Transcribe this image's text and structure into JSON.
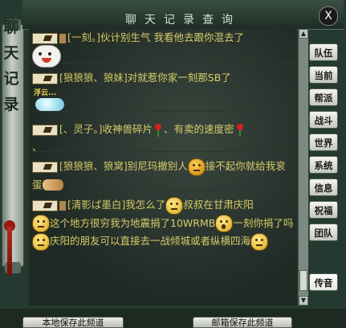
{
  "window": {
    "title": "聊天记录查询",
    "close_label": "X"
  },
  "side_banner": {
    "chars": [
      "聊",
      "天",
      "记",
      "录"
    ]
  },
  "messages": [
    {
      "sender": "[一刻。]",
      "text": "伙计别生气 我看他去跟你混去了",
      "sticker": "smile-face-icon"
    },
    {
      "sender": "[狼狼狼、狼妹]",
      "text": "对就惹你家一刻那SB了",
      "sticker_label": "浮云..."
    },
    {
      "sender": "[、灵子。]",
      "text_a": "收神兽碎片",
      "text_b": "、有卖的速度密",
      "text_c": "、"
    },
    {
      "sender": "[狼狼狼、狼窝]",
      "text_a": "别尼玛撤别人",
      "text_b": "接不起你就给我衮蛋"
    },
    {
      "sender": "[清影ぱ墨白]",
      "text_a": "我怎么了",
      "text_b": "叔叔在甘肃庆阳",
      "text_c": "这个地方很穷我为地震捐了10WRMB",
      "text_d": "一刻你捐了吗",
      "text_e": "庆阳的朋友可以直接去一战倾城或者纵横四海"
    }
  ],
  "tabs": [
    "队伍",
    "当前",
    "帮派",
    "战斗",
    "世界",
    "系统",
    "信息",
    "祝福",
    "团队",
    "传音"
  ],
  "bottom_buttons": [
    "本地保存此频道",
    "邮箱保存此频道"
  ]
}
